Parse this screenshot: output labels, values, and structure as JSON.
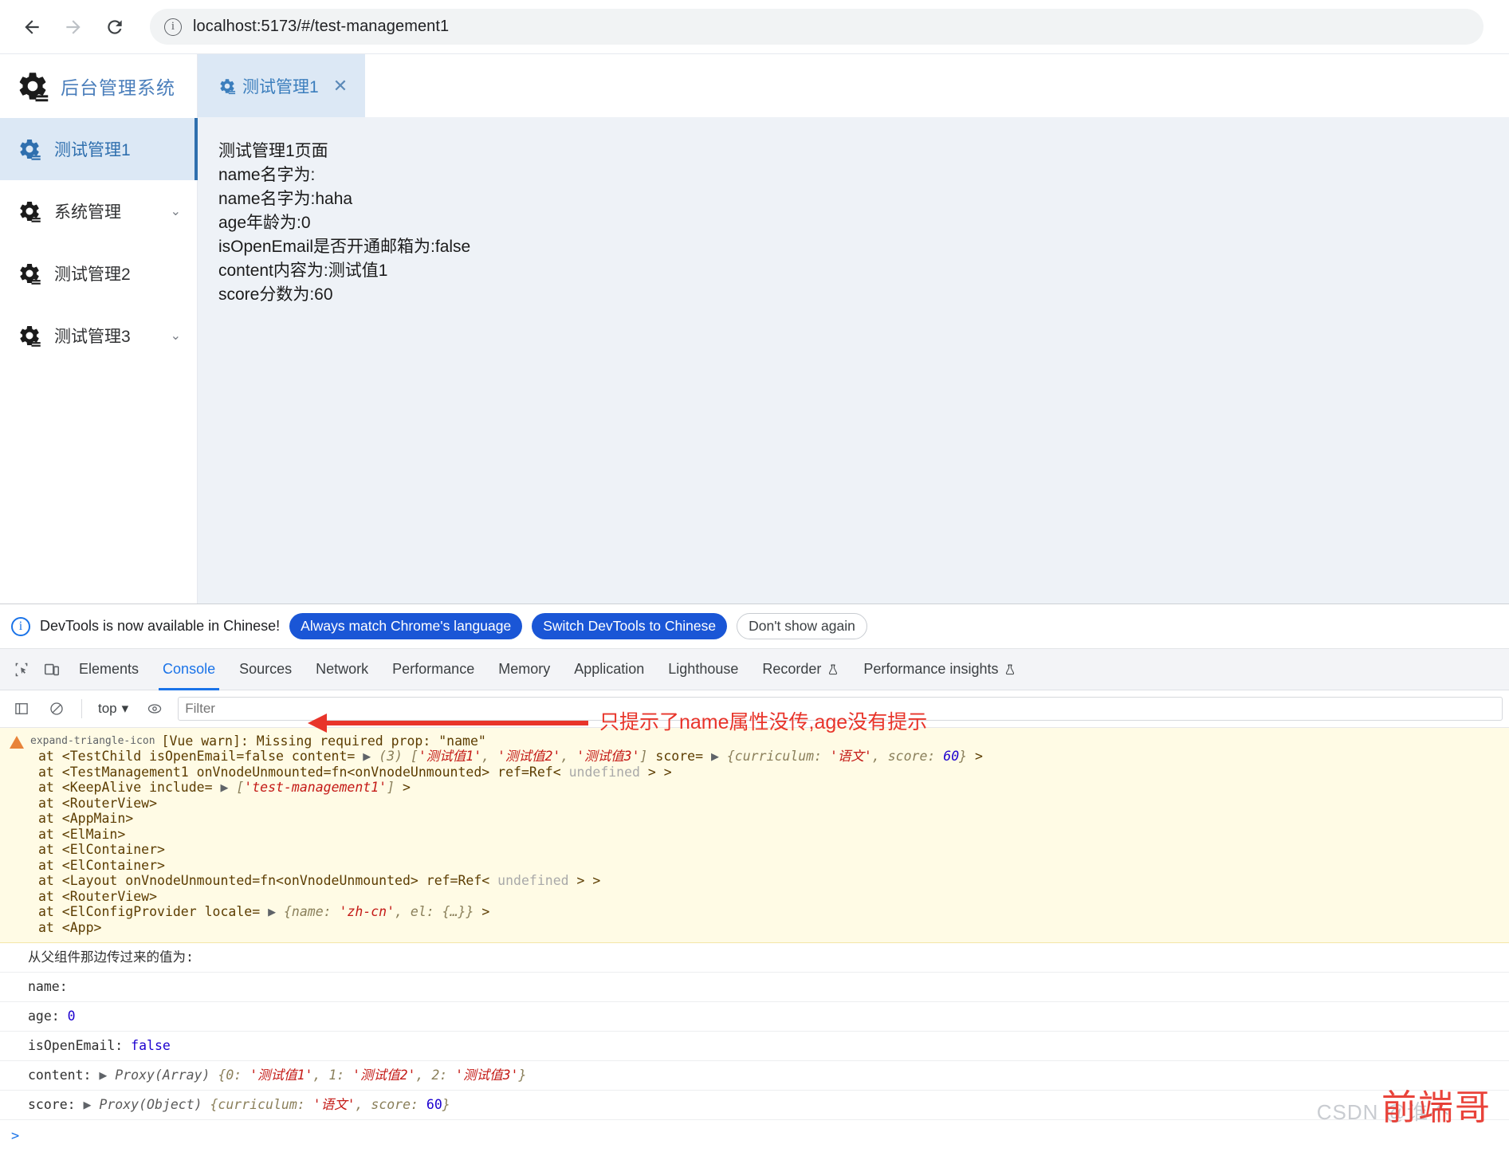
{
  "browser": {
    "back_icon": "arrow-left-icon",
    "forward_icon": "arrow-right-icon",
    "reload_icon": "reload-icon",
    "site_info_icon": "info-circle-icon",
    "url": "localhost:5173/#/test-management1"
  },
  "app": {
    "brand": "后台管理系统",
    "brand_icon": "gear-icon",
    "sidebar": [
      {
        "label": "测试管理1",
        "icon": "gear-icon",
        "active": true,
        "expandable": false
      },
      {
        "label": "系统管理",
        "icon": "gear-icon",
        "active": false,
        "expandable": true
      },
      {
        "label": "测试管理2",
        "icon": "gear-icon",
        "active": false,
        "expandable": false
      },
      {
        "label": "测试管理3",
        "icon": "gear-icon",
        "active": false,
        "expandable": true
      }
    ],
    "tab": {
      "label": "测试管理1",
      "icon": "gear-icon",
      "close": "✕"
    },
    "page_lines": [
      "测试管理1页面",
      "name名字为:",
      "name名字为:haha",
      "age年龄为:0",
      "isOpenEmail是否开通邮箱为:false",
      "content内容为:测试值1",
      "score分数为:60"
    ]
  },
  "devtools": {
    "notice": {
      "icon": "info-circle-icon",
      "text": "DevTools is now available in Chinese!",
      "primary1": "Always match Chrome's language",
      "primary2": "Switch DevTools to Chinese",
      "ghost": "Don't show again"
    },
    "inspect_icon": "inspect-element-icon",
    "device_icon": "device-toolbar-icon",
    "tabs": [
      {
        "label": "Elements",
        "selected": false,
        "flask": false
      },
      {
        "label": "Console",
        "selected": true,
        "flask": false
      },
      {
        "label": "Sources",
        "selected": false,
        "flask": false
      },
      {
        "label": "Network",
        "selected": false,
        "flask": false
      },
      {
        "label": "Performance",
        "selected": false,
        "flask": false
      },
      {
        "label": "Memory",
        "selected": false,
        "flask": false
      },
      {
        "label": "Application",
        "selected": false,
        "flask": false
      },
      {
        "label": "Lighthouse",
        "selected": false,
        "flask": false
      },
      {
        "label": "Recorder",
        "selected": false,
        "flask": true
      },
      {
        "label": "Performance insights",
        "selected": false,
        "flask": true
      }
    ],
    "toolbar": {
      "sidebar_icon": "console-sidebar-icon",
      "clear_icon": "clear-console-icon",
      "context": "top",
      "context_caret": "▾",
      "eye_icon": "live-expression-icon",
      "filter_placeholder": "Filter",
      "filter_value": ""
    },
    "console": {
      "warning_icon": "warning-triangle-icon",
      "expand_icon": "expand-triangle-icon",
      "warning_title": "[Vue warn]: Missing required prop: \"name\"",
      "stack": [
        "at <TestChild isOpenEmail=false content=  ▶ (3) ['测试值1', '测试值2', '测试值3'] score=  ▶ {curriculum: '语文', score: 60} >",
        "at <TestManagement1 onVnodeUnmounted=fn<onVnodeUnmounted> ref=Ref< undefined > >",
        "at <KeepAlive include=  ▶ ['test-management1'] >",
        "at <RouterView>",
        "at <AppMain>",
        "at <ElMain>",
        "at <ElContainer>",
        "at <ElContainer>",
        "at <Layout onVnodeUnmounted=fn<onVnodeUnmounted> ref=Ref< undefined > >",
        "at <RouterView>",
        "at <ElConfigProvider locale=  ▶ {name: 'zh-cn', el: {…}} >",
        "at <App>"
      ],
      "logs": [
        "从父组件那边传过来的值为:",
        "name:",
        "age: 0",
        "isOpenEmail: false",
        "content:  ▶ Proxy(Array) {0: '测试值1', 1: '测试值2', 2: '测试值3'}",
        "score:  ▶ Proxy(Object) {curriculum: '语文', score: 60}"
      ],
      "prompt": ">"
    }
  },
  "annotation": {
    "text": "只提示了name属性没传,age没有提示",
    "color": "#e8342a"
  },
  "watermark": {
    "gray": "CSDN @谁不",
    "red": "前端哥"
  },
  "colors": {
    "accent": "#1a73e8",
    "menu_active_bg": "#dce8f5",
    "menu_active_text": "#2f6fae",
    "warn_bg": "#fffbe5",
    "content_bg": "#eef2f7"
  }
}
